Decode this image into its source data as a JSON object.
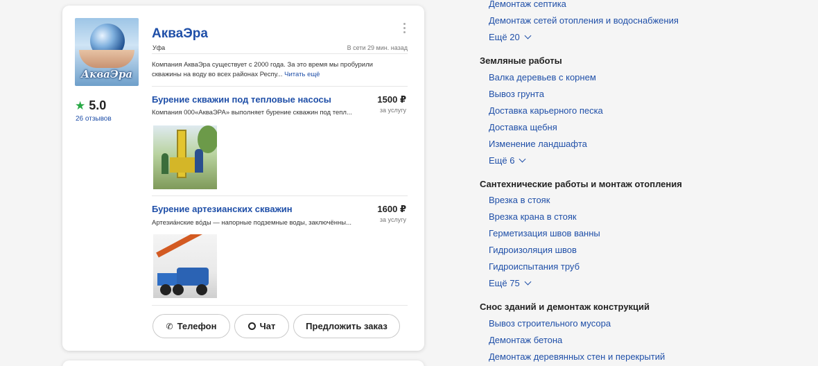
{
  "card": {
    "logo_text": "АкваЭра",
    "rating": "5.0",
    "reviews": "26 отзывов",
    "company": "АкваЭра",
    "city": "Уфа",
    "online": "В сети 29 мин. назад",
    "description": "Компания АкваЭра существует с 2000 года. За это время мы пробурили скважины на воду во всех районах Респу...",
    "read_more": "Читать ещё",
    "services": [
      {
        "title": "Бурение скважин под тепловые насосы",
        "text": "Компания 000«АкваЭРА» выполняет бурение скважин под тепл...",
        "price": "1500 ₽",
        "unit": "за услугу"
      },
      {
        "title": "Бурение артезианских скважин",
        "text": "Артезиа́нские во́ды — напорные подземные воды, заключённы...",
        "price": "1600 ₽",
        "unit": "за услугу"
      }
    ],
    "buttons": {
      "phone": "Телефон",
      "chat": "Чат",
      "order": "Предложить заказ"
    }
  },
  "categories": {
    "top_links": [
      "Демонтаж септика",
      "Демонтаж сетей отопления и водоснабжения"
    ],
    "top_more": "Ещё 20",
    "earth": {
      "title": "Земляные работы",
      "links": [
        "Валка деревьев с корнем",
        "Вывоз грунта",
        "Доставка карьерного песка",
        "Доставка щебня",
        "Изменение ландшафта"
      ],
      "more": "Ещё 6"
    },
    "plumbing": {
      "title": "Сантехнические работы и монтаж отопления",
      "links": [
        "Врезка в стояк",
        "Врезка крана в стояк",
        "Герметизация швов ванны",
        "Гидроизоляция швов",
        "Гидроиспытания труб"
      ],
      "more": "Ещё 75"
    },
    "demolition": {
      "title": "Снос зданий и демонтаж конструкций",
      "links": [
        "Вывоз строительного мусора",
        "Демонтаж бетона",
        "Демонтаж деревянных стен и перекрытий"
      ]
    }
  }
}
